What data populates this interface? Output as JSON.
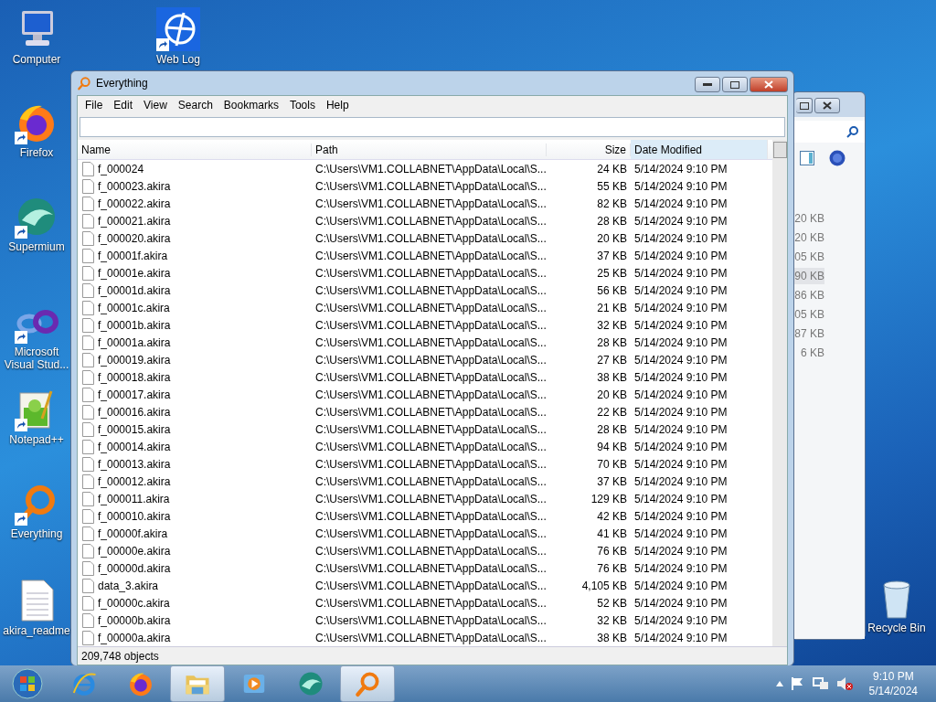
{
  "desktop_icons": [
    {
      "label": "Computer",
      "kind": "computer",
      "shortcut": false
    },
    {
      "label": "Web Log",
      "kind": "weblog",
      "shortcut": true
    },
    {
      "label": "Firefox",
      "kind": "firefox",
      "shortcut": true
    },
    {
      "label": "Supermium",
      "kind": "supermium",
      "shortcut": true
    },
    {
      "label": "Microsoft Visual Stud...",
      "kind": "vstudio",
      "shortcut": true
    },
    {
      "label": "Notepad++",
      "kind": "notepad",
      "shortcut": true
    },
    {
      "label": "Everything",
      "kind": "everything",
      "shortcut": true
    },
    {
      "label": "akira_readme",
      "kind": "document",
      "shortcut": false
    },
    {
      "label": "Recycle Bin",
      "kind": "recycle",
      "shortcut": false
    }
  ],
  "background_window": {
    "sizes": [
      {
        "text": "20 KB",
        "selected": false
      },
      {
        "text": "20 KB",
        "selected": false
      },
      {
        "text": "05 KB",
        "selected": false
      },
      {
        "text": "90 KB",
        "selected": true
      },
      {
        "text": "86 KB",
        "selected": false
      },
      {
        "text": "05 KB",
        "selected": false
      },
      {
        "text": "87 KB",
        "selected": false
      },
      {
        "text": "6 KB",
        "selected": false
      }
    ]
  },
  "window": {
    "title": "Everything",
    "menu": [
      "File",
      "Edit",
      "View",
      "Search",
      "Bookmarks",
      "Tools",
      "Help"
    ],
    "table": {
      "columns": [
        "Name",
        "Path",
        "Size",
        "Date Modified"
      ],
      "rows": [
        {
          "name": "f_000024",
          "path": "C:\\Users\\VM1.COLLABNET\\AppData\\Local\\S...",
          "size": "24 KB",
          "date": "5/14/2024 9:10 PM"
        },
        {
          "name": "f_000023.akira",
          "path": "C:\\Users\\VM1.COLLABNET\\AppData\\Local\\S...",
          "size": "55 KB",
          "date": "5/14/2024 9:10 PM"
        },
        {
          "name": "f_000022.akira",
          "path": "C:\\Users\\VM1.COLLABNET\\AppData\\Local\\S...",
          "size": "82 KB",
          "date": "5/14/2024 9:10 PM"
        },
        {
          "name": "f_000021.akira",
          "path": "C:\\Users\\VM1.COLLABNET\\AppData\\Local\\S...",
          "size": "28 KB",
          "date": "5/14/2024 9:10 PM"
        },
        {
          "name": "f_000020.akira",
          "path": "C:\\Users\\VM1.COLLABNET\\AppData\\Local\\S...",
          "size": "20 KB",
          "date": "5/14/2024 9:10 PM"
        },
        {
          "name": "f_00001f.akira",
          "path": "C:\\Users\\VM1.COLLABNET\\AppData\\Local\\S...",
          "size": "37 KB",
          "date": "5/14/2024 9:10 PM"
        },
        {
          "name": "f_00001e.akira",
          "path": "C:\\Users\\VM1.COLLABNET\\AppData\\Local\\S...",
          "size": "25 KB",
          "date": "5/14/2024 9:10 PM"
        },
        {
          "name": "f_00001d.akira",
          "path": "C:\\Users\\VM1.COLLABNET\\AppData\\Local\\S...",
          "size": "56 KB",
          "date": "5/14/2024 9:10 PM"
        },
        {
          "name": "f_00001c.akira",
          "path": "C:\\Users\\VM1.COLLABNET\\AppData\\Local\\S...",
          "size": "21 KB",
          "date": "5/14/2024 9:10 PM"
        },
        {
          "name": "f_00001b.akira",
          "path": "C:\\Users\\VM1.COLLABNET\\AppData\\Local\\S...",
          "size": "32 KB",
          "date": "5/14/2024 9:10 PM"
        },
        {
          "name": "f_00001a.akira",
          "path": "C:\\Users\\VM1.COLLABNET\\AppData\\Local\\S...",
          "size": "28 KB",
          "date": "5/14/2024 9:10 PM"
        },
        {
          "name": "f_000019.akira",
          "path": "C:\\Users\\VM1.COLLABNET\\AppData\\Local\\S...",
          "size": "27 KB",
          "date": "5/14/2024 9:10 PM"
        },
        {
          "name": "f_000018.akira",
          "path": "C:\\Users\\VM1.COLLABNET\\AppData\\Local\\S...",
          "size": "38 KB",
          "date": "5/14/2024 9:10 PM"
        },
        {
          "name": "f_000017.akira",
          "path": "C:\\Users\\VM1.COLLABNET\\AppData\\Local\\S...",
          "size": "20 KB",
          "date": "5/14/2024 9:10 PM"
        },
        {
          "name": "f_000016.akira",
          "path": "C:\\Users\\VM1.COLLABNET\\AppData\\Local\\S...",
          "size": "22 KB",
          "date": "5/14/2024 9:10 PM"
        },
        {
          "name": "f_000015.akira",
          "path": "C:\\Users\\VM1.COLLABNET\\AppData\\Local\\S...",
          "size": "28 KB",
          "date": "5/14/2024 9:10 PM"
        },
        {
          "name": "f_000014.akira",
          "path": "C:\\Users\\VM1.COLLABNET\\AppData\\Local\\S...",
          "size": "94 KB",
          "date": "5/14/2024 9:10 PM"
        },
        {
          "name": "f_000013.akira",
          "path": "C:\\Users\\VM1.COLLABNET\\AppData\\Local\\S...",
          "size": "70 KB",
          "date": "5/14/2024 9:10 PM"
        },
        {
          "name": "f_000012.akira",
          "path": "C:\\Users\\VM1.COLLABNET\\AppData\\Local\\S...",
          "size": "37 KB",
          "date": "5/14/2024 9:10 PM"
        },
        {
          "name": "f_000011.akira",
          "path": "C:\\Users\\VM1.COLLABNET\\AppData\\Local\\S...",
          "size": "129 KB",
          "date": "5/14/2024 9:10 PM"
        },
        {
          "name": "f_000010.akira",
          "path": "C:\\Users\\VM1.COLLABNET\\AppData\\Local\\S...",
          "size": "42 KB",
          "date": "5/14/2024 9:10 PM"
        },
        {
          "name": "f_00000f.akira",
          "path": "C:\\Users\\VM1.COLLABNET\\AppData\\Local\\S...",
          "size": "41 KB",
          "date": "5/14/2024 9:10 PM"
        },
        {
          "name": "f_00000e.akira",
          "path": "C:\\Users\\VM1.COLLABNET\\AppData\\Local\\S...",
          "size": "76 KB",
          "date": "5/14/2024 9:10 PM"
        },
        {
          "name": "f_00000d.akira",
          "path": "C:\\Users\\VM1.COLLABNET\\AppData\\Local\\S...",
          "size": "76 KB",
          "date": "5/14/2024 9:10 PM"
        },
        {
          "name": "data_3.akira",
          "path": "C:\\Users\\VM1.COLLABNET\\AppData\\Local\\S...",
          "size": "4,105 KB",
          "date": "5/14/2024 9:10 PM"
        },
        {
          "name": "f_00000c.akira",
          "path": "C:\\Users\\VM1.COLLABNET\\AppData\\Local\\S...",
          "size": "52 KB",
          "date": "5/14/2024 9:10 PM"
        },
        {
          "name": "f_00000b.akira",
          "path": "C:\\Users\\VM1.COLLABNET\\AppData\\Local\\S...",
          "size": "32 KB",
          "date": "5/14/2024 9:10 PM"
        },
        {
          "name": "f_00000a.akira",
          "path": "C:\\Users\\VM1.COLLABNET\\AppData\\Local\\S...",
          "size": "38 KB",
          "date": "5/14/2024 9:10 PM"
        }
      ]
    },
    "status_bar": "209,748 objects"
  },
  "taskbar": {
    "items": [
      {
        "kind": "ie",
        "selected": false
      },
      {
        "kind": "firefox",
        "selected": false
      },
      {
        "kind": "explorer",
        "selected": true
      },
      {
        "kind": "media",
        "selected": false
      },
      {
        "kind": "supermium",
        "selected": false
      },
      {
        "kind": "everything",
        "selected": true
      }
    ],
    "time": "9:10 PM",
    "date": "5/14/2024"
  }
}
